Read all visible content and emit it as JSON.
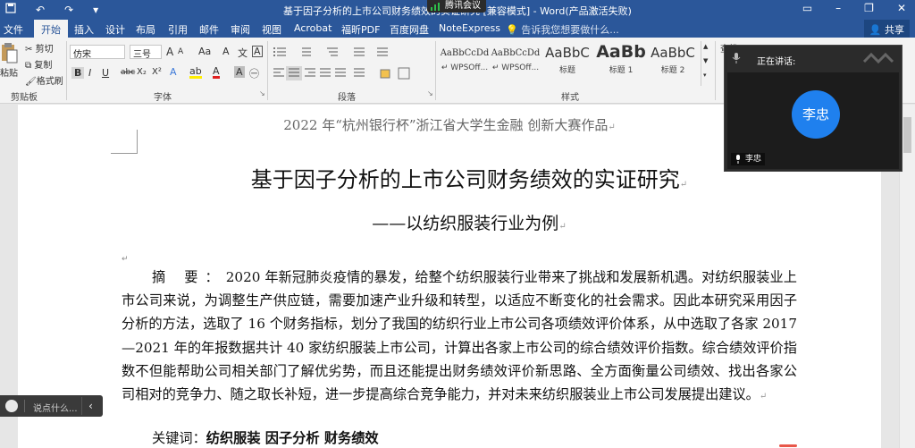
{
  "titlebar": {
    "title": "基于因子分析的上市公司财务绩效的实证研究 [兼容模式] - Word(产品激活失败)",
    "quick_access": [
      "↶",
      "↷",
      "▾"
    ],
    "window_controls": [
      "▭",
      "–",
      "❐",
      "✕"
    ]
  },
  "meeting_badge": {
    "label": "腾讯会议"
  },
  "menu": {
    "tabs": [
      "文件",
      "开始",
      "插入",
      "设计",
      "布局",
      "引用",
      "邮件",
      "审阅",
      "视图",
      "Acrobat",
      "福昕PDF",
      "百度网盘",
      "NoteExpress"
    ],
    "active_tab": "开始",
    "tell_me": "告诉我您想要做什么...",
    "share": "共享"
  },
  "ribbon": {
    "clipboard": {
      "paste": "粘贴",
      "cut": "剪切",
      "copy": "复制",
      "format_painter": "格式刷",
      "label": "剪贴板"
    },
    "font": {
      "font_name": "仿宋",
      "font_size": "三号",
      "grow": "A",
      "shrink": "A",
      "case": "Aa",
      "clear": "A",
      "phonetic": "文",
      "border": "A",
      "bold": "B",
      "italic": "I",
      "underline": "U",
      "strike": "abc",
      "sub": "X₂",
      "sup": "X²",
      "effects": "A",
      "highlight": "ab",
      "color": "A",
      "shade": "A",
      "enclose": "㊀",
      "label": "字体"
    },
    "paragraph": {
      "label": "段落"
    },
    "styles": {
      "items": [
        {
          "preview": "AaBbCcDd",
          "name": "↵ WPSOff..."
        },
        {
          "preview": "AaBbCcDd",
          "name": "↵ WPSOff..."
        },
        {
          "preview": "AaBbC",
          "name": "标题"
        },
        {
          "preview": "AaBb",
          "name": "标题 1"
        },
        {
          "preview": "AaBbC",
          "name": "标题 2"
        }
      ],
      "label": "样式"
    },
    "editing": {
      "find": "查找"
    }
  },
  "document": {
    "header": "2022 年“杭州银行杯”浙江省大学生金融 创新大赛作品",
    "title": "基于因子分析的上市公司财务绩效的实证研究",
    "subtitle": "——以纺织服装行业为例",
    "abstract_label": "摘 要：",
    "abstract_text": "2020 年新冠肺炎疫情的暴发，给整个纺织服装行业带来了挑战和发展新机遇。对纺织服装业上市公司来说，为调整生产供应链，需要加速产业升级和转型，以适应不断变化的社会需求。因此本研究采用因子分析的方法，选取了 16 个财务指标，划分了我国的纺织行业上市公司各项绩效评价体系，从中选取了各家 2017—2021 年的年报数据共计 40 家纺织服装上市公司，计算出各家上市公司的综合绩效评价指数。综合绩效评价指数不但能帮助公司相关部门了解优劣势，而且还能提出财务绩效评价新思路、全方面衡量公司绩效、找出各家公司相对的竞争力、随之取长补短，进一步提高综合竞争能力，并对未来纺织服装业上市公司发展提出建议。",
    "keywords_label": "关键词：",
    "keywords": "纺织服装 因子分析 财务绩效"
  },
  "meeting": {
    "speaking_label": "正在讲话:",
    "avatar_text": "李忠",
    "participant_name": "李忠"
  },
  "comment_bar": {
    "placeholder": "说点什么...",
    "collapse": "‹"
  },
  "colors": {
    "word_blue": "#2b579a",
    "avatar_blue": "#1f80ee",
    "meeting_bg": "#2b2b2b"
  }
}
